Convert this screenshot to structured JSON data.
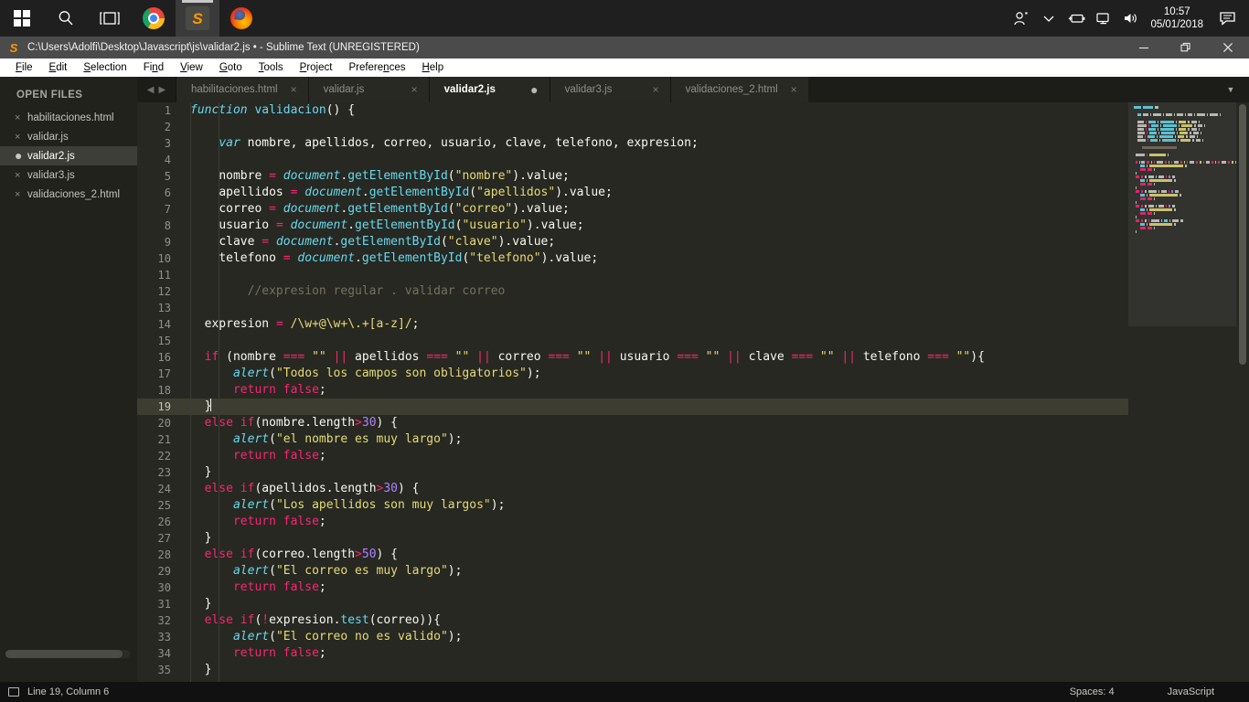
{
  "taskbar": {
    "start_label": "Start",
    "search_label": "Search",
    "taskview_label": "Task View",
    "apps": [
      {
        "name": "chrome",
        "label": "Google Chrome",
        "active": false
      },
      {
        "name": "sublime",
        "label": "Sublime Text",
        "active": true
      },
      {
        "name": "firefox",
        "label": "Mozilla Firefox",
        "active": false
      }
    ],
    "tray": {
      "people_label": "People",
      "chevron_label": "Show hidden icons",
      "battery_label": "Battery",
      "network_label": "Network",
      "volume_label": "Volume",
      "time": "10:57",
      "date": "05/01/2018",
      "notifications_label": "Notifications"
    }
  },
  "window": {
    "title": "C:\\Users\\Adolfi\\Desktop\\Javascript\\js\\validar2.js • - Sublime Text (UNREGISTERED)",
    "minimize_label": "—",
    "maximize_label": "❐",
    "close_label": "✕"
  },
  "menubar": {
    "items": [
      {
        "pre": "",
        "accel": "F",
        "post": "ile"
      },
      {
        "pre": "",
        "accel": "E",
        "post": "dit"
      },
      {
        "pre": "",
        "accel": "S",
        "post": "election"
      },
      {
        "pre": "Fi",
        "accel": "n",
        "post": "d"
      },
      {
        "pre": "",
        "accel": "V",
        "post": "iew"
      },
      {
        "pre": "",
        "accel": "G",
        "post": "oto"
      },
      {
        "pre": "",
        "accel": "T",
        "post": "ools"
      },
      {
        "pre": "",
        "accel": "P",
        "post": "roject"
      },
      {
        "pre": "Prefere",
        "accel": "n",
        "post": "ces"
      },
      {
        "pre": "",
        "accel": "H",
        "post": "elp"
      }
    ]
  },
  "sidebar": {
    "title": "OPEN FILES",
    "files": [
      {
        "label": "habilitaciones.html",
        "selected": false,
        "modified": false
      },
      {
        "label": "validar.js",
        "selected": false,
        "modified": false
      },
      {
        "label": "validar2.js",
        "selected": true,
        "modified": true
      },
      {
        "label": "validar3.js",
        "selected": false,
        "modified": false
      },
      {
        "label": "validaciones_2.html",
        "selected": false,
        "modified": false
      }
    ]
  },
  "tabs": {
    "prev_label": "◀",
    "next_label": "▶",
    "menu_label": "▼",
    "items": [
      {
        "label": "habilitaciones.html",
        "active": false,
        "modified": false,
        "close": "×"
      },
      {
        "label": "validar.js",
        "active": false,
        "modified": false,
        "close": "×"
      },
      {
        "label": "validar2.js",
        "active": true,
        "modified": true,
        "close": "●"
      },
      {
        "label": "validar3.js",
        "active": false,
        "modified": false,
        "close": "×"
      },
      {
        "label": "validaciones_2.html",
        "active": false,
        "modified": false,
        "close": "×"
      }
    ]
  },
  "editor": {
    "first_line": 1,
    "current_line": 19,
    "lines": [
      {
        "n": 1,
        "text": "function validacion() {"
      },
      {
        "n": 2,
        "text": ""
      },
      {
        "n": 3,
        "text": "    var nombre, apellidos, correo, usuario, clave, telefono, expresion;"
      },
      {
        "n": 4,
        "text": ""
      },
      {
        "n": 5,
        "text": "    nombre = document.getElementById(\"nombre\").value;"
      },
      {
        "n": 6,
        "text": "    apellidos = document.getElementById(\"apellidos\").value;"
      },
      {
        "n": 7,
        "text": "    correo = document.getElementById(\"correo\").value;"
      },
      {
        "n": 8,
        "text": "    usuario = document.getElementById(\"usuario\").value;"
      },
      {
        "n": 9,
        "text": "    clave = document.getElementById(\"clave\").value;"
      },
      {
        "n": 10,
        "text": "    telefono = document.getElementById(\"telefono\").value;"
      },
      {
        "n": 11,
        "text": ""
      },
      {
        "n": 12,
        "text": "        //expresion regular . validar correo"
      },
      {
        "n": 13,
        "text": ""
      },
      {
        "n": 14,
        "text": "  expresion = /\\w+@\\w+\\.+[a-z]/;"
      },
      {
        "n": 15,
        "text": ""
      },
      {
        "n": 16,
        "text": "  if (nombre === \"\" || apellidos === \"\" || correo === \"\" || usuario === \"\" || clave === \"\" || telefono === \"\"){"
      },
      {
        "n": 17,
        "text": "      alert(\"Todos los campos son obligatorios\");"
      },
      {
        "n": 18,
        "text": "      return false;"
      },
      {
        "n": 19,
        "text": "  }"
      },
      {
        "n": 20,
        "text": "  else if(nombre.length>30) {"
      },
      {
        "n": 21,
        "text": "      alert(\"el nombre es muy largo\");"
      },
      {
        "n": 22,
        "text": "      return false;"
      },
      {
        "n": 23,
        "text": "  }"
      },
      {
        "n": 24,
        "text": "  else if(apellidos.length>30) {"
      },
      {
        "n": 25,
        "text": "      alert(\"Los apellidos son muy largos\");"
      },
      {
        "n": 26,
        "text": "      return false;"
      },
      {
        "n": 27,
        "text": "  }"
      },
      {
        "n": 28,
        "text": "  else if(correo.length>50) {"
      },
      {
        "n": 29,
        "text": "      alert(\"El correo es muy largo\");"
      },
      {
        "n": 30,
        "text": "      return false;"
      },
      {
        "n": 31,
        "text": "  }"
      },
      {
        "n": 32,
        "text": "  else if(!expresion.test(correo)){"
      },
      {
        "n": 33,
        "text": "      alert(\"El correo no es valido\");"
      },
      {
        "n": 34,
        "text": "      return false;"
      },
      {
        "n": 35,
        "text": "  }"
      }
    ]
  },
  "statusbar": {
    "cursor": "Line 19, Column 6",
    "indent": "Spaces: 4",
    "syntax": "JavaScript"
  },
  "colors": {
    "bg": "#272822",
    "keyword": "#f92672",
    "string": "#e6db74",
    "function": "#a6e22e",
    "number": "#ae81ff",
    "comment": "#75715e",
    "storage": "#66d9ef",
    "foreground": "#f8f8f2",
    "line_highlight": "#3e3d32"
  }
}
